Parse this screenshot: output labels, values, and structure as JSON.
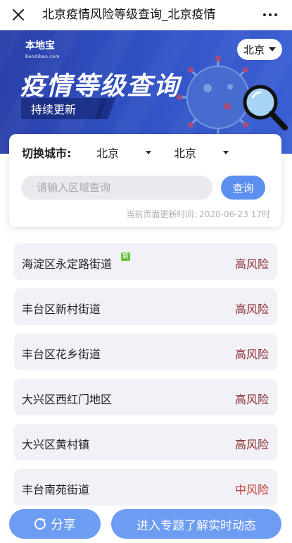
{
  "topbar": {
    "title": "北京疫情风险等级查询_北京疫情"
  },
  "banner": {
    "logo_text": "本地宝",
    "logo_sub": "Bendibao.com",
    "title": "疫情等级查询",
    "pill": "持续更新",
    "city": "北京"
  },
  "search": {
    "switch_label": "切换城市:",
    "province": "北京",
    "city": "北京",
    "placeholder": "请输入区域查询",
    "query_label": "查询",
    "update_time": "当前页面更新时间: 2020-06-23 17时"
  },
  "colors": {
    "high_risk": "#8b2b2b",
    "medium_risk": "#c0392b",
    "accent": "#6d9cf3"
  },
  "list": [
    {
      "name": "海淀区永定路街道",
      "risk": "高风险",
      "badge": "新"
    },
    {
      "name": "丰台区新村街道",
      "risk": "高风险"
    },
    {
      "name": "丰台区花乡街道",
      "risk": "高风险"
    },
    {
      "name": "大兴区西红门地区",
      "risk": "高风险"
    },
    {
      "name": "大兴区黄村镇",
      "risk": "高风险"
    },
    {
      "name": "丰台南苑街道",
      "risk": "中风险"
    }
  ],
  "bottom": {
    "share_label": "分享",
    "enter_label": "进入专题了解实时动态"
  }
}
